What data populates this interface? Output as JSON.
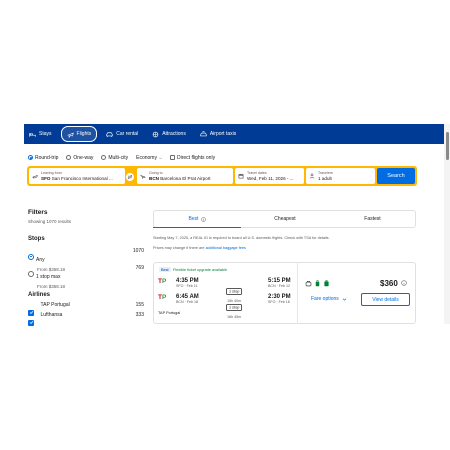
{
  "nav": {
    "tabs": [
      {
        "label": "Stays",
        "icon": "bed-icon"
      },
      {
        "label": "Flights",
        "icon": "plane-icon",
        "active": true
      },
      {
        "label": "Car rental",
        "icon": "car-icon"
      },
      {
        "label": "Attractions",
        "icon": "attractions-icon"
      },
      {
        "label": "Airport taxis",
        "icon": "taxi-icon"
      }
    ]
  },
  "trip_options": {
    "round_trip": "Round-trip",
    "one_way": "One-way",
    "multi_city": "Multi-city",
    "cabin": "Economy",
    "direct_only": "Direct flights only",
    "selected": "Round-trip"
  },
  "search": {
    "from_label": "Leaving from",
    "from_code": "SFO",
    "from_value": "San Francisco International ...",
    "to_label": "Going to",
    "to_code": "BCN",
    "to_value": "Barcelona El Prat Airport",
    "dates_label": "Travel dates",
    "dates_value": "Wed, Feb 11, 2026 - ...",
    "travelers_label": "Travelers",
    "travelers_value": "1 adult",
    "button": "Search"
  },
  "filters": {
    "title": "Filters",
    "showing": "Showing 1070 results",
    "stops_title": "Stops",
    "stops": [
      {
        "label": "Any",
        "price": "From $358.18",
        "count": "1070",
        "selected": true
      },
      {
        "label": "1 stop max",
        "price": "From $358.18",
        "count": "769",
        "selected": false
      }
    ],
    "airlines_title": "Airlines",
    "airlines": [
      {
        "label": "TAP Portugal",
        "count": "155",
        "checked": true
      },
      {
        "label": "Lufthansa",
        "count": "333",
        "checked": true
      }
    ]
  },
  "sort": {
    "tabs": [
      "Best",
      "Cheapest",
      "Fastest"
    ],
    "active": "Best"
  },
  "notice": {
    "real_id": "Starting May 7, 2025, a REAL ID is required to board all U.S. domestic flights. Check with TSA for details.",
    "prices_text": "Prices may change if there are",
    "baggage_link": "additional baggage fees"
  },
  "result": {
    "best_badge": "Best",
    "flex_badge": "Flexible ticket upgrade available",
    "outbound": {
      "depart_time": "4:35 PM",
      "depart_info": "SFO · Feb 11",
      "stops": "1 stop",
      "duration": "15h 40m",
      "arrive_time": "5:15 PM",
      "arrive_info": "BCN · Feb 12"
    },
    "return": {
      "depart_time": "6:45 AM",
      "depart_info": "BCN · Feb 18",
      "stops": "1 stop",
      "duration": "16h 45m",
      "arrive_time": "2:30 PM",
      "arrive_info": "SFO · Feb 18"
    },
    "airline": "TAP Portugal",
    "price": "$360",
    "fare_options": "Fare options",
    "view_details": "View details"
  },
  "colors": {
    "nav": "#003b95",
    "accent": "#006ce4",
    "searchbar": "#ffb700",
    "flex_green": "#008234"
  }
}
